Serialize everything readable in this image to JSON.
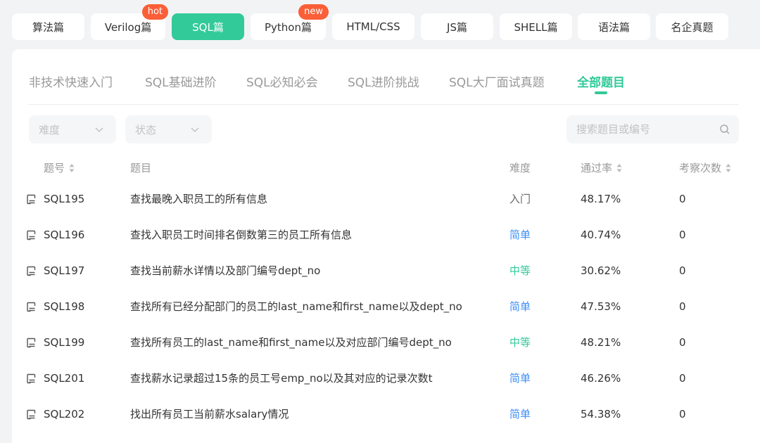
{
  "categories": [
    {
      "label": "算法篇",
      "active": false,
      "badge": ""
    },
    {
      "label": "Verilog篇",
      "active": false,
      "badge": "hot"
    },
    {
      "label": "SQL篇",
      "active": true,
      "badge": ""
    },
    {
      "label": "Python篇",
      "active": false,
      "badge": "new"
    },
    {
      "label": "HTML/CSS",
      "active": false,
      "badge": ""
    },
    {
      "label": "JS篇",
      "active": false,
      "badge": ""
    },
    {
      "label": "SHELL篇",
      "active": false,
      "badge": ""
    },
    {
      "label": "语法篇",
      "active": false,
      "badge": ""
    },
    {
      "label": "名企真题",
      "active": false,
      "badge": ""
    }
  ],
  "sub_tabs": [
    {
      "label": "非技术快速入门",
      "active": false
    },
    {
      "label": "SQL基础进阶",
      "active": false
    },
    {
      "label": "SQL必知必会",
      "active": false
    },
    {
      "label": "SQL进阶挑战",
      "active": false
    },
    {
      "label": "SQL大厂面试真题",
      "active": false
    },
    {
      "label": "全部题目",
      "active": true
    }
  ],
  "filters": {
    "difficulty_label": "难度",
    "status_label": "状态",
    "search_placeholder": "搜索题目或编号"
  },
  "table": {
    "headers": {
      "id": "题号",
      "title": "题目",
      "difficulty": "难度",
      "pass_rate": "通过率",
      "exam_count": "考察次数"
    },
    "rows": [
      {
        "id": "SQL195",
        "title": "查找最晚入职员工的所有信息",
        "difficulty": "入门",
        "pass_rate": "48.17%",
        "exam_count": "0"
      },
      {
        "id": "SQL196",
        "title": "查找入职员工时间排名倒数第三的员工所有信息",
        "difficulty": "简单",
        "pass_rate": "40.74%",
        "exam_count": "0"
      },
      {
        "id": "SQL197",
        "title": "查找当前薪水详情以及部门编号dept_no",
        "difficulty": "中等",
        "pass_rate": "30.62%",
        "exam_count": "0"
      },
      {
        "id": "SQL198",
        "title": "查找所有已经分配部门的员工的last_name和first_name以及dept_no",
        "difficulty": "简单",
        "pass_rate": "47.53%",
        "exam_count": "0"
      },
      {
        "id": "SQL199",
        "title": "查找所有员工的last_name和first_name以及对应部门编号dept_no",
        "difficulty": "中等",
        "pass_rate": "48.21%",
        "exam_count": "0"
      },
      {
        "id": "SQL201",
        "title": "查找薪水记录超过15条的员工号emp_no以及其对应的记录次数t",
        "difficulty": "简单",
        "pass_rate": "46.26%",
        "exam_count": "0"
      },
      {
        "id": "SQL202",
        "title": "找出所有员工当前薪水salary情况",
        "difficulty": "简单",
        "pass_rate": "54.38%",
        "exam_count": "0"
      }
    ]
  },
  "colors": {
    "accent": "#32ca99",
    "badge": "#fa5f37",
    "difficulty": {
      "入门": "#666666",
      "简单": "#3e8ef7",
      "中等": "#32ca99"
    }
  },
  "icons": {
    "row_icon": "problem-doc-icon",
    "search_icon": "search-icon",
    "sort_icon": "sort-icon",
    "chevron_icon": "chevron-down-icon"
  }
}
